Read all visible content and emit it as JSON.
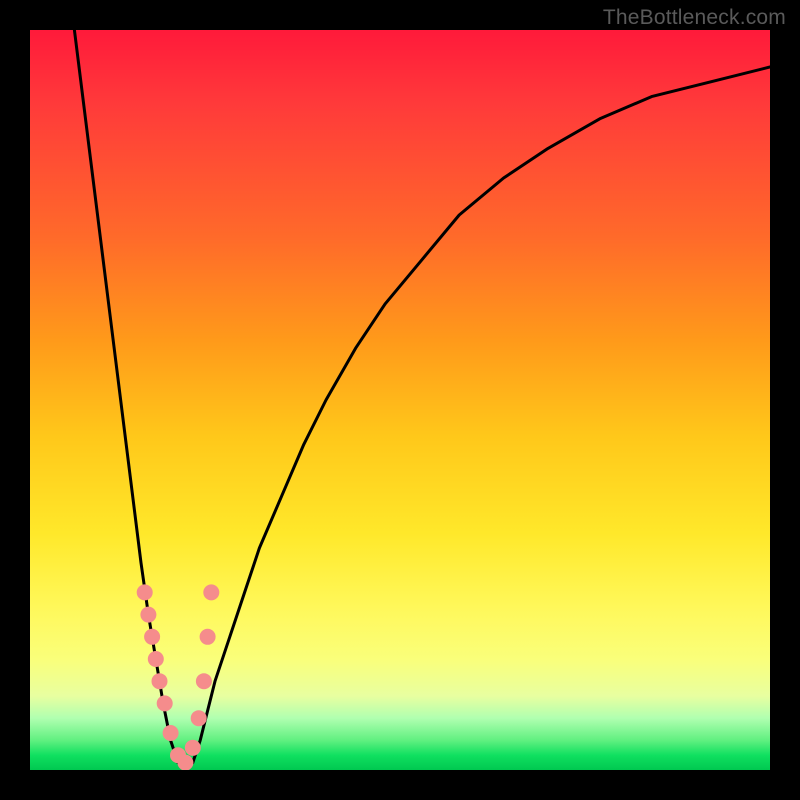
{
  "watermark": "TheBottleneck.com",
  "chart_data": {
    "type": "line",
    "title": "",
    "xlabel": "",
    "ylabel": "",
    "xlim": [
      0,
      100
    ],
    "ylim": [
      0,
      100
    ],
    "axes_visible": false,
    "background": "vertical-gradient red→orange→yellow→green",
    "series": [
      {
        "name": "bottleneck-curve",
        "x": [
          6,
          7,
          8,
          9,
          10,
          11,
          12,
          13,
          14,
          15,
          16,
          17,
          18,
          19,
          20,
          21,
          22,
          23,
          24,
          25,
          27,
          29,
          31,
          34,
          37,
          40,
          44,
          48,
          53,
          58,
          64,
          70,
          77,
          84,
          92,
          100
        ],
        "y": [
          100,
          92,
          84,
          76,
          68,
          60,
          52,
          44,
          36,
          28,
          21,
          15,
          9,
          4,
          1,
          0,
          1,
          4,
          8,
          12,
          18,
          24,
          30,
          37,
          44,
          50,
          57,
          63,
          69,
          75,
          80,
          84,
          88,
          91,
          93,
          95
        ]
      }
    ],
    "points": {
      "name": "highlighted-points",
      "x": [
        15.5,
        16.0,
        16.5,
        17.0,
        17.5,
        18.2,
        19.0,
        20.0,
        21.0,
        22.0,
        22.8,
        23.5,
        24.0,
        24.5
      ],
      "y": [
        24,
        21,
        18,
        15,
        12,
        9,
        5,
        2,
        1,
        3,
        7,
        12,
        18,
        24
      ]
    }
  }
}
